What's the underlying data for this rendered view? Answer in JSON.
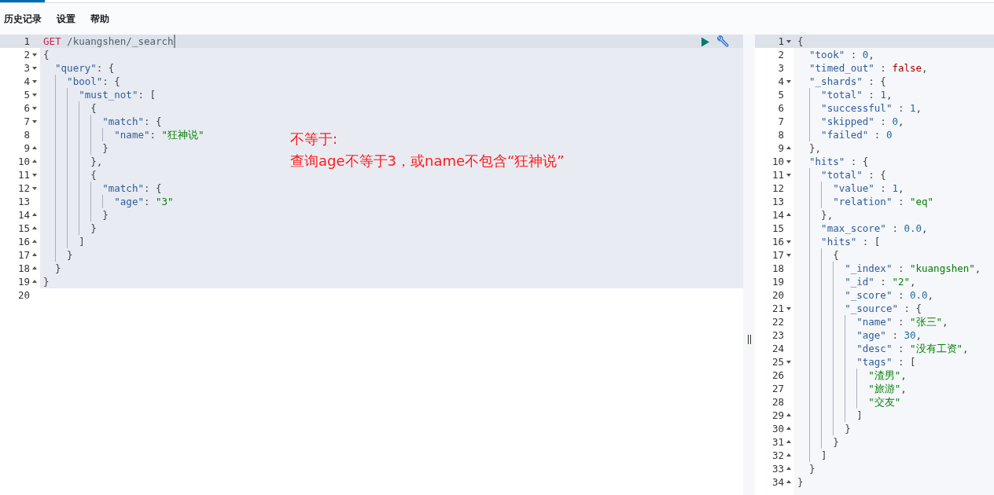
{
  "menu": [
    {
      "label": "历史记录"
    },
    {
      "label": "设置"
    },
    {
      "label": "帮助"
    }
  ],
  "request": {
    "lines": [
      {
        "num": "1",
        "kind": "plain",
        "active": true,
        "highlighted": true,
        "tokens": [
          {
            "kind": "method",
            "text": "GET"
          },
          {
            "kind": "url",
            "text": " /kuangshen/_search"
          }
        ]
      },
      {
        "num": "2",
        "kind": "fold-start",
        "active": false,
        "highlighted": true,
        "tokens": [
          {
            "kind": "punct",
            "text": "{"
          }
        ]
      },
      {
        "num": "3",
        "kind": "fold-start",
        "active": false,
        "highlighted": true,
        "tokens": [
          {
            "kind": "key",
            "text": "  \"query\""
          },
          {
            "kind": "punct",
            "text": ": {"
          }
        ]
      },
      {
        "num": "4",
        "kind": "fold-start",
        "active": false,
        "highlighted": true,
        "tokens": [
          {
            "kind": "key",
            "text": "    \"bool\""
          },
          {
            "kind": "punct",
            "text": ": {"
          }
        ]
      },
      {
        "num": "5",
        "kind": "fold-start",
        "active": false,
        "highlighted": true,
        "tokens": [
          {
            "kind": "key",
            "text": "      \"must_not\""
          },
          {
            "kind": "punct",
            "text": ": ["
          }
        ]
      },
      {
        "num": "6",
        "kind": "fold-start",
        "active": false,
        "highlighted": true,
        "tokens": [
          {
            "kind": "punct",
            "text": "        {"
          }
        ]
      },
      {
        "num": "7",
        "kind": "fold-start",
        "active": false,
        "highlighted": true,
        "tokens": [
          {
            "kind": "key",
            "text": "          \"match\""
          },
          {
            "kind": "punct",
            "text": ": {"
          }
        ]
      },
      {
        "num": "8",
        "kind": "plain",
        "active": false,
        "highlighted": true,
        "tokens": [
          {
            "kind": "key",
            "text": "            \"name\""
          },
          {
            "kind": "punct",
            "text": ": "
          },
          {
            "kind": "string",
            "text": "\"狂神说\""
          }
        ]
      },
      {
        "num": "9",
        "kind": "fold-end",
        "active": false,
        "highlighted": true,
        "tokens": [
          {
            "kind": "punct",
            "text": "          }"
          }
        ]
      },
      {
        "num": "10",
        "kind": "fold-end",
        "active": false,
        "highlighted": true,
        "tokens": [
          {
            "kind": "punct",
            "text": "        },"
          }
        ]
      },
      {
        "num": "11",
        "kind": "fold-start",
        "active": false,
        "highlighted": true,
        "tokens": [
          {
            "kind": "punct",
            "text": "        {"
          }
        ]
      },
      {
        "num": "12",
        "kind": "fold-start",
        "active": false,
        "highlighted": true,
        "tokens": [
          {
            "kind": "key",
            "text": "          \"match\""
          },
          {
            "kind": "punct",
            "text": ": {"
          }
        ]
      },
      {
        "num": "13",
        "kind": "plain",
        "active": false,
        "highlighted": true,
        "tokens": [
          {
            "kind": "key",
            "text": "            \"age\""
          },
          {
            "kind": "punct",
            "text": ": "
          },
          {
            "kind": "string",
            "text": "\"3\""
          }
        ]
      },
      {
        "num": "14",
        "kind": "fold-end",
        "active": false,
        "highlighted": true,
        "tokens": [
          {
            "kind": "punct",
            "text": "          }"
          }
        ]
      },
      {
        "num": "15",
        "kind": "fold-end",
        "active": false,
        "highlighted": true,
        "tokens": [
          {
            "kind": "punct",
            "text": "        }"
          }
        ]
      },
      {
        "num": "16",
        "kind": "fold-end",
        "active": false,
        "highlighted": true,
        "tokens": [
          {
            "kind": "punct",
            "text": "      ]"
          }
        ]
      },
      {
        "num": "17",
        "kind": "fold-end",
        "active": false,
        "highlighted": true,
        "tokens": [
          {
            "kind": "punct",
            "text": "    }"
          }
        ]
      },
      {
        "num": "18",
        "kind": "fold-end",
        "active": false,
        "highlighted": true,
        "tokens": [
          {
            "kind": "punct",
            "text": "  }"
          }
        ]
      },
      {
        "num": "19",
        "kind": "fold-end",
        "active": false,
        "highlighted": true,
        "tokens": [
          {
            "kind": "punct",
            "text": "}"
          }
        ]
      },
      {
        "num": "20",
        "kind": "plain",
        "active": false,
        "highlighted": false
      }
    ],
    "annotation": [
      "不等于:",
      "查询age不等于3，或name不包含“狂神说”"
    ]
  },
  "response": {
    "lines": [
      {
        "num": "1",
        "kind": "fold-start",
        "active": true,
        "tokens": [
          {
            "kind": "punct",
            "text": "{"
          }
        ]
      },
      {
        "num": "2",
        "kind": "plain",
        "active": false,
        "tokens": [
          {
            "kind": "key",
            "text": "  \"took\""
          },
          {
            "kind": "punct",
            "text": " : "
          },
          {
            "kind": "number",
            "text": "0"
          },
          {
            "kind": "punct",
            "text": ","
          }
        ]
      },
      {
        "num": "3",
        "kind": "plain",
        "active": false,
        "tokens": [
          {
            "kind": "key",
            "text": "  \"timed_out\""
          },
          {
            "kind": "punct",
            "text": " : "
          },
          {
            "kind": "boolean",
            "text": "false"
          },
          {
            "kind": "punct",
            "text": ","
          }
        ]
      },
      {
        "num": "4",
        "kind": "fold-start",
        "active": false,
        "tokens": [
          {
            "kind": "key",
            "text": "  \"_shards\""
          },
          {
            "kind": "punct",
            "text": " : {"
          }
        ]
      },
      {
        "num": "5",
        "kind": "plain",
        "active": false,
        "tokens": [
          {
            "kind": "key",
            "text": "    \"total\""
          },
          {
            "kind": "punct",
            "text": " : "
          },
          {
            "kind": "number",
            "text": "1"
          },
          {
            "kind": "punct",
            "text": ","
          }
        ]
      },
      {
        "num": "6",
        "kind": "plain",
        "active": false,
        "tokens": [
          {
            "kind": "key",
            "text": "    \"successful\""
          },
          {
            "kind": "punct",
            "text": " : "
          },
          {
            "kind": "number",
            "text": "1"
          },
          {
            "kind": "punct",
            "text": ","
          }
        ]
      },
      {
        "num": "7",
        "kind": "plain",
        "active": false,
        "tokens": [
          {
            "kind": "key",
            "text": "    \"skipped\""
          },
          {
            "kind": "punct",
            "text": " : "
          },
          {
            "kind": "number",
            "text": "0"
          },
          {
            "kind": "punct",
            "text": ","
          }
        ]
      },
      {
        "num": "8",
        "kind": "plain",
        "active": false,
        "tokens": [
          {
            "kind": "key",
            "text": "    \"failed\""
          },
          {
            "kind": "punct",
            "text": " : "
          },
          {
            "kind": "number",
            "text": "0"
          }
        ]
      },
      {
        "num": "9",
        "kind": "fold-end",
        "active": false,
        "tokens": [
          {
            "kind": "punct",
            "text": "  },"
          }
        ]
      },
      {
        "num": "10",
        "kind": "fold-start",
        "active": false,
        "tokens": [
          {
            "kind": "key",
            "text": "  \"hits\""
          },
          {
            "kind": "punct",
            "text": " : {"
          }
        ]
      },
      {
        "num": "11",
        "kind": "fold-start",
        "active": false,
        "tokens": [
          {
            "kind": "key",
            "text": "    \"total\""
          },
          {
            "kind": "punct",
            "text": " : {"
          }
        ]
      },
      {
        "num": "12",
        "kind": "plain",
        "active": false,
        "tokens": [
          {
            "kind": "key",
            "text": "      \"value\""
          },
          {
            "kind": "punct",
            "text": " : "
          },
          {
            "kind": "number",
            "text": "1"
          },
          {
            "kind": "punct",
            "text": ","
          }
        ]
      },
      {
        "num": "13",
        "kind": "plain",
        "active": false,
        "tokens": [
          {
            "kind": "key",
            "text": "      \"relation\""
          },
          {
            "kind": "punct",
            "text": " : "
          },
          {
            "kind": "string",
            "text": "\"eq\""
          }
        ]
      },
      {
        "num": "14",
        "kind": "fold-end",
        "active": false,
        "tokens": [
          {
            "kind": "punct",
            "text": "    },"
          }
        ]
      },
      {
        "num": "15",
        "kind": "plain",
        "active": false,
        "tokens": [
          {
            "kind": "key",
            "text": "    \"max_score\""
          },
          {
            "kind": "punct",
            "text": " : "
          },
          {
            "kind": "number",
            "text": "0.0"
          },
          {
            "kind": "punct",
            "text": ","
          }
        ]
      },
      {
        "num": "16",
        "kind": "fold-start",
        "active": false,
        "tokens": [
          {
            "kind": "key",
            "text": "    \"hits\""
          },
          {
            "kind": "punct",
            "text": " : ["
          }
        ]
      },
      {
        "num": "17",
        "kind": "fold-start",
        "active": false,
        "tokens": [
          {
            "kind": "punct",
            "text": "      {"
          }
        ]
      },
      {
        "num": "18",
        "kind": "plain",
        "active": false,
        "tokens": [
          {
            "kind": "key",
            "text": "        \"_index\""
          },
          {
            "kind": "punct",
            "text": " : "
          },
          {
            "kind": "string",
            "text": "\"kuangshen\""
          },
          {
            "kind": "punct",
            "text": ","
          }
        ]
      },
      {
        "num": "19",
        "kind": "plain",
        "active": false,
        "tokens": [
          {
            "kind": "key",
            "text": "        \"_id\""
          },
          {
            "kind": "punct",
            "text": " : "
          },
          {
            "kind": "string",
            "text": "\"2\""
          },
          {
            "kind": "punct",
            "text": ","
          }
        ]
      },
      {
        "num": "20",
        "kind": "plain",
        "active": false,
        "tokens": [
          {
            "kind": "key",
            "text": "        \"_score\""
          },
          {
            "kind": "punct",
            "text": " : "
          },
          {
            "kind": "number",
            "text": "0.0"
          },
          {
            "kind": "punct",
            "text": ","
          }
        ]
      },
      {
        "num": "21",
        "kind": "fold-start",
        "active": false,
        "tokens": [
          {
            "kind": "key",
            "text": "        \"_source\""
          },
          {
            "kind": "punct",
            "text": " : {"
          }
        ]
      },
      {
        "num": "22",
        "kind": "plain",
        "active": false,
        "tokens": [
          {
            "kind": "key",
            "text": "          \"name\""
          },
          {
            "kind": "punct",
            "text": " : "
          },
          {
            "kind": "string",
            "text": "\"张三\""
          },
          {
            "kind": "punct",
            "text": ","
          }
        ]
      },
      {
        "num": "23",
        "kind": "plain",
        "active": false,
        "tokens": [
          {
            "kind": "key",
            "text": "          \"age\""
          },
          {
            "kind": "punct",
            "text": " : "
          },
          {
            "kind": "number",
            "text": "30"
          },
          {
            "kind": "punct",
            "text": ","
          }
        ]
      },
      {
        "num": "24",
        "kind": "plain",
        "active": false,
        "tokens": [
          {
            "kind": "key",
            "text": "          \"desc\""
          },
          {
            "kind": "punct",
            "text": " : "
          },
          {
            "kind": "string",
            "text": "\"没有工资\""
          },
          {
            "kind": "punct",
            "text": ","
          }
        ]
      },
      {
        "num": "25",
        "kind": "fold-start",
        "active": false,
        "tokens": [
          {
            "kind": "key",
            "text": "          \"tags\""
          },
          {
            "kind": "punct",
            "text": " : ["
          }
        ]
      },
      {
        "num": "26",
        "kind": "plain",
        "active": false,
        "tokens": [
          {
            "kind": "string",
            "text": "            \"渣男\""
          },
          {
            "kind": "punct",
            "text": ","
          }
        ]
      },
      {
        "num": "27",
        "kind": "plain",
        "active": false,
        "tokens": [
          {
            "kind": "string",
            "text": "            \"旅游\""
          },
          {
            "kind": "punct",
            "text": ","
          }
        ]
      },
      {
        "num": "28",
        "kind": "plain",
        "active": false,
        "tokens": [
          {
            "kind": "string",
            "text": "            \"交友\""
          }
        ]
      },
      {
        "num": "29",
        "kind": "fold-end",
        "active": false,
        "tokens": [
          {
            "kind": "punct",
            "text": "          ]"
          }
        ]
      },
      {
        "num": "30",
        "kind": "fold-end",
        "active": false,
        "tokens": [
          {
            "kind": "punct",
            "text": "        }"
          }
        ]
      },
      {
        "num": "31",
        "kind": "fold-end",
        "active": false,
        "tokens": [
          {
            "kind": "punct",
            "text": "      }"
          }
        ]
      },
      {
        "num": "32",
        "kind": "fold-end",
        "active": false,
        "tokens": [
          {
            "kind": "punct",
            "text": "    ]"
          }
        ]
      },
      {
        "num": "33",
        "kind": "fold-end",
        "active": false,
        "tokens": [
          {
            "kind": "punct",
            "text": "  }"
          }
        ]
      },
      {
        "num": "34",
        "kind": "fold-end",
        "active": false,
        "tokens": [
          {
            "kind": "punct",
            "text": "}"
          }
        ]
      }
    ]
  }
}
